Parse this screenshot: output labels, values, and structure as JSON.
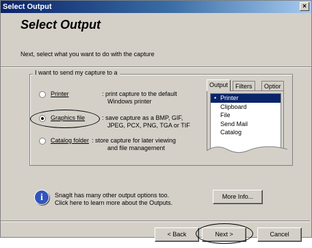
{
  "window": {
    "title": "Select Output",
    "close_glyph": "×"
  },
  "header": {
    "title": "Select Output",
    "subtitle": "Next, select what you want to do with the capture"
  },
  "group": {
    "legend": "I want to send my capture to a",
    "options": [
      {
        "label": "Printer",
        "desc1": ": print capture to the default",
        "desc2": "Windows printer",
        "selected": false
      },
      {
        "label": "Graphics file",
        "desc1": ": save capture as a BMP, GIF,",
        "desc2": "JPEG, PCX, PNG, TGA or TIF",
        "selected": true
      },
      {
        "label": "Catalog folder",
        "desc1": ": store capture for later viewing",
        "desc2": "and file management",
        "selected": false
      }
    ]
  },
  "tabs": {
    "labels": [
      "Output",
      "Filters",
      "Optior"
    ],
    "items": [
      "Printer",
      "Clipboard",
      "File",
      "Send Mail",
      "Catalog"
    ],
    "selected_index": 0
  },
  "info": {
    "icon": "i",
    "line1": "SnagIt has many other output options too.",
    "line2": "Click here to learn more about the Outputs."
  },
  "buttons": {
    "more_info": "More Info...",
    "back": "< Back",
    "next": "Next >",
    "cancel": "Cancel"
  }
}
